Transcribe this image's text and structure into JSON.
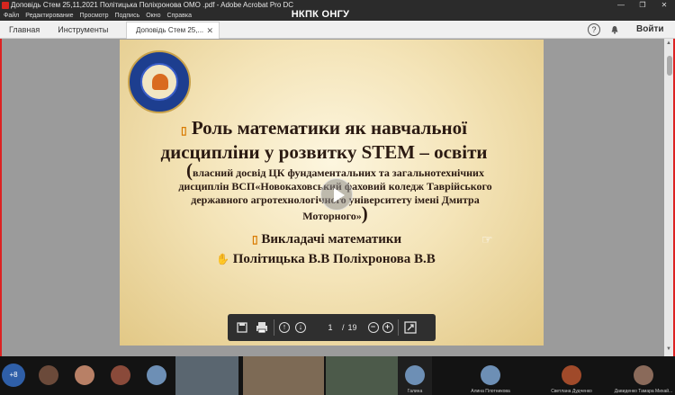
{
  "window": {
    "title": "Доповідь Стем 25,11,2021 Політицька Поліхронова ОМО .pdf - Adobe Acrobat Pro DC",
    "meeting_banner": "НКПК ОНГУ"
  },
  "menu": [
    "Файл",
    "Редактирование",
    "Просмотр",
    "Подпись",
    "Окно",
    "Справка"
  ],
  "tabs": {
    "home": "Главная",
    "tools": "Инструменты",
    "document": "Доповідь Стем 25,...",
    "signin": "Войти"
  },
  "slide": {
    "title": "Роль математики  як навчальної дисципліни  у  розвитку STEM – освіти",
    "subtitle_open": "(",
    "subtitle": "власний досвід ЦК фундаментальних та загальнотехнічних дисциплін ВСП«Новокаховський фаховий коледж Таврійського державного агротехнологічного університету імені Дмитра Моторного»",
    "subtitle_close": ")",
    "teachers_label": "Викладачі математики",
    "teachers_names": "Політицька В.В Поліхронова В.В"
  },
  "pdf_toolbar": {
    "current_page": "1",
    "page_separator": "/",
    "total_pages": "19"
  },
  "participants": {
    "more_count": "+8",
    "names": [
      "Галина",
      "Алина Плотникова",
      "Светлана Дудченко",
      "Давиденко Тамара Михай..."
    ]
  },
  "colors": {
    "title_bar": "#2b2b2b",
    "slide_text": "#2b1a12",
    "bullet": "#d97a00",
    "accent_border": "#dd2222"
  }
}
